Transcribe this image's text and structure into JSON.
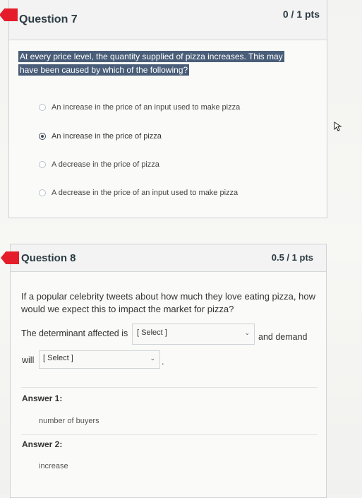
{
  "q7": {
    "title": "Question 7",
    "points": "0 / 1 pts",
    "prompt_line1": "At every price level, the quantity supplied of pizza increases. This may",
    "prompt_line2": "have been caused by which of the following?",
    "options": [
      {
        "label": "An increase in the price of an input used to make pizza",
        "selected": false
      },
      {
        "label": "An increase in the price of pizza",
        "selected": true
      },
      {
        "label": "A decrease in the price of pizza",
        "selected": false
      },
      {
        "label": "A decrease in the price of an input used to make pizza",
        "selected": false
      }
    ]
  },
  "q8": {
    "title": "Question 8",
    "points": "0.5 / 1 pts",
    "prompt": "If a popular celebrity tweets about how much they love eating pizza, how would we expect this to impact the market for pizza?",
    "sentence_part1": "The determinant affected is",
    "select1": "[ Select ]",
    "sentence_part2": "and demand",
    "sentence_part3": "will",
    "select2": "[ Select ]",
    "sentence_end": ".",
    "answer1_label": "Answer 1:",
    "answer1_value": "number of buyers",
    "answer2_label": "Answer 2:",
    "answer2_value": "increase"
  },
  "colors": {
    "flag": "#e51d2a",
    "highlight": "#4a5e79"
  },
  "icons": {
    "dropdown": "chevron-down-icon",
    "cursor": "mouse-cursor-icon"
  }
}
